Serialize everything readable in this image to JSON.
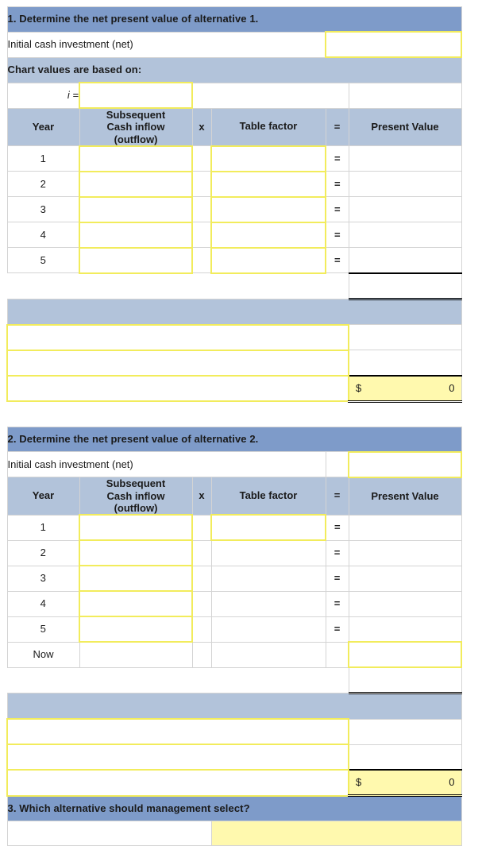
{
  "document": {
    "type": "worksheet",
    "accent_header_dark": "#7e9bc9",
    "accent_header_light": "#b2c3da",
    "input_border": "#f2ec5c",
    "input_fill": "#fff9ae"
  },
  "section1": {
    "title": "1.  Determine the net present value of alternative 1.",
    "initial_label": "Initial cash investment (net)",
    "initial_value": "",
    "basis_label": "Chart values are based on:",
    "i_label": "i =",
    "i_value": "",
    "columns": {
      "year": "Year",
      "cash_line1": "Subsequent",
      "cash_line2": "Cash inflow",
      "cash_line3": "(outflow)",
      "times": "x",
      "factor": "Table factor",
      "equals": "=",
      "present_value": "Present Value"
    },
    "rows": [
      {
        "year": "1",
        "cash": "",
        "eq": "=",
        "factor": "",
        "pv": ""
      },
      {
        "year": "2",
        "cash": "",
        "eq": "=",
        "factor": "",
        "pv": ""
      },
      {
        "year": "3",
        "cash": "",
        "eq": "=",
        "factor": "",
        "pv": ""
      },
      {
        "year": "4",
        "cash": "",
        "eq": "=",
        "factor": "",
        "pv": ""
      },
      {
        "year": "5",
        "cash": "",
        "eq": "=",
        "factor": "",
        "pv": ""
      }
    ],
    "subtotal_value": "",
    "summary_rows": [
      {
        "label": "",
        "value": ""
      },
      {
        "label": "",
        "value": ""
      }
    ],
    "net_row": {
      "label": "",
      "currency": "$",
      "value": "0"
    }
  },
  "section2": {
    "title": "2.  Determine the net present value of alternative 2.",
    "initial_label": "Initial cash investment (net)",
    "initial_value": "",
    "columns": {
      "year": "Year",
      "cash_line1": "Subsequent",
      "cash_line2": "Cash inflow",
      "cash_line3": "(outflow)",
      "times": "x",
      "factor": "Table factor",
      "equals": "=",
      "present_value": "Present Value"
    },
    "rows": [
      {
        "year": "1",
        "cash": "",
        "eq": "=",
        "factor": "",
        "pv": "",
        "factor_input": true,
        "pv_input": false
      },
      {
        "year": "2",
        "cash": "",
        "eq": "=",
        "factor": "",
        "pv": "",
        "factor_input": false,
        "pv_input": false
      },
      {
        "year": "3",
        "cash": "",
        "eq": "=",
        "factor": "",
        "pv": "",
        "factor_input": false,
        "pv_input": false
      },
      {
        "year": "4",
        "cash": "",
        "eq": "=",
        "factor": "",
        "pv": "",
        "factor_input": false,
        "pv_input": false
      },
      {
        "year": "5",
        "cash": "",
        "eq": "=",
        "factor": "",
        "pv": "",
        "factor_input": false,
        "pv_input": false
      },
      {
        "year": "Now",
        "cash": "",
        "eq": "",
        "factor": "",
        "pv": "",
        "factor_input": false,
        "pv_input": true
      }
    ],
    "subtotal_value": "",
    "summary_rows": [
      {
        "label": "",
        "value": ""
      },
      {
        "label": "",
        "value": ""
      }
    ],
    "net_row": {
      "label": "",
      "currency": "$",
      "value": "0"
    }
  },
  "section3": {
    "title": "3.  Which alternative should management select?",
    "answer_prompt": "",
    "answer_value": ""
  }
}
